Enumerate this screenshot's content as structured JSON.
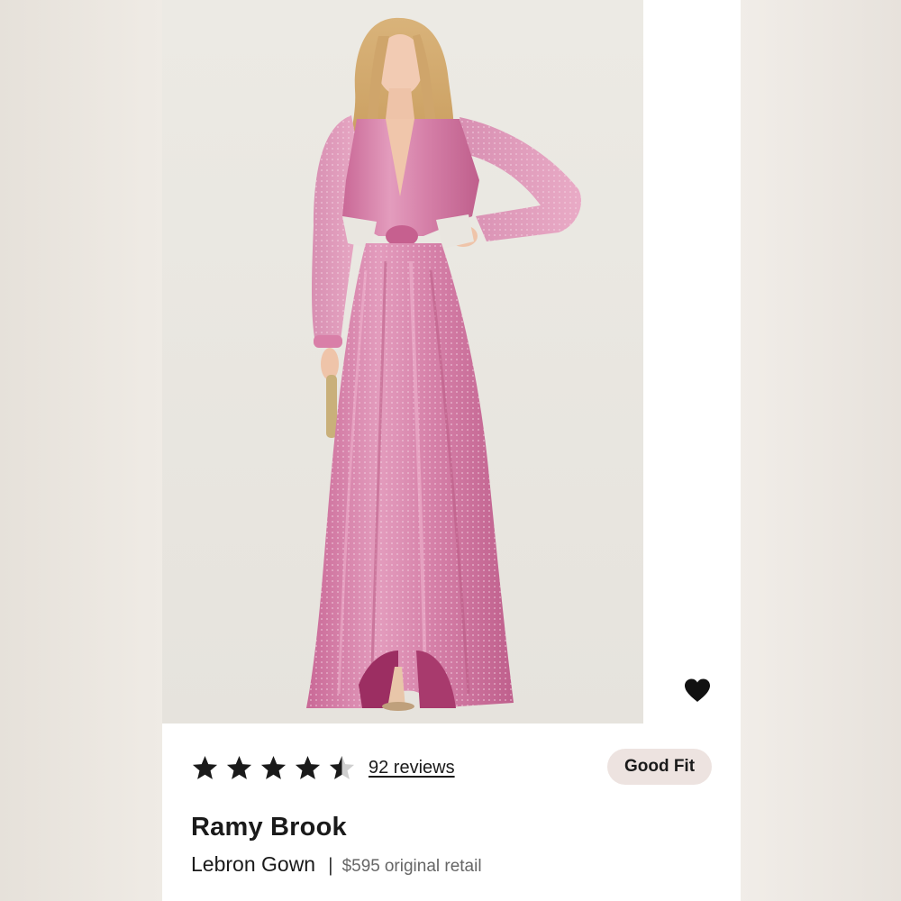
{
  "product": {
    "brand": "Ramy Brook",
    "name": "Lebron Gown",
    "separator": "|",
    "price": "$595",
    "price_suffix": "original retail"
  },
  "rating": {
    "value": 4.5,
    "max": 5,
    "reviews_text": "92 reviews"
  },
  "fit_badge": "Good Fit",
  "favorite_icon": "heart-icon",
  "colors": {
    "gown": "#d77aa5",
    "badge_bg": "#ede3e0",
    "text": "#1a1a1a"
  }
}
